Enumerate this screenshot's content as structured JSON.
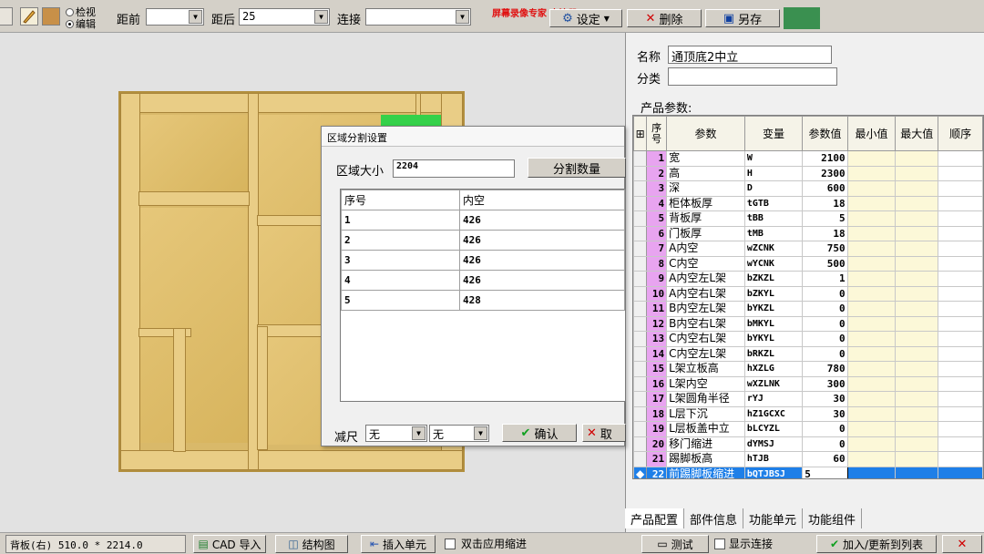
{
  "toolbar": {
    "radio_view": "检视",
    "radio_edit": "编辑",
    "dist_front_label": "距前",
    "dist_front_value": "",
    "dist_back_label": "距后",
    "dist_back_value": "25",
    "connect_label": "连接",
    "connect_value": "",
    "watermark": "屏幕录像专家 未注册",
    "settings_btn": "设定",
    "delete_btn": "删除",
    "saveas_btn": "另存"
  },
  "right_panel": {
    "name_label": "名称",
    "name_value": "通顶底2中立",
    "category_label": "分类",
    "category_value": "",
    "params_title": "产品参数:",
    "columns": [
      "序号",
      "参数",
      "变量",
      "参数值",
      "最小值",
      "最大值",
      "顺序"
    ],
    "rows": [
      {
        "n": "1",
        "param": "宽",
        "var": "W",
        "val": "2100"
      },
      {
        "n": "2",
        "param": "高",
        "var": "H",
        "val": "2300"
      },
      {
        "n": "3",
        "param": "深",
        "var": "D",
        "val": "600"
      },
      {
        "n": "4",
        "param": "柜体板厚",
        "var": "tGTB",
        "val": "18"
      },
      {
        "n": "5",
        "param": "背板厚",
        "var": "tBB",
        "val": "5"
      },
      {
        "n": "6",
        "param": "门板厚",
        "var": "tMB",
        "val": "18"
      },
      {
        "n": "7",
        "param": "A内空",
        "var": "wZCNK",
        "val": "750"
      },
      {
        "n": "8",
        "param": "C内空",
        "var": "wYCNK",
        "val": "500"
      },
      {
        "n": "9",
        "param": "A内空左L架",
        "var": "bZKZL",
        "val": "1"
      },
      {
        "n": "10",
        "param": "A内空右L架",
        "var": "bZKYL",
        "val": "0"
      },
      {
        "n": "11",
        "param": "B内空左L架",
        "var": "bYKZL",
        "val": "0"
      },
      {
        "n": "12",
        "param": "B内空右L架",
        "var": "bMKYL",
        "val": "0"
      },
      {
        "n": "13",
        "param": "C内空右L架",
        "var": "bYKYL",
        "val": "0"
      },
      {
        "n": "14",
        "param": "C内空左L架",
        "var": "bRKZL",
        "val": "0"
      },
      {
        "n": "15",
        "param": "L架立板高",
        "var": "hXZLG",
        "val": "780"
      },
      {
        "n": "16",
        "param": "L架内空",
        "var": "wXZLNK",
        "val": "300"
      },
      {
        "n": "17",
        "param": "L架圆角半径",
        "var": "rYJ",
        "val": "30"
      },
      {
        "n": "18",
        "param": "L层下沉",
        "var": "hZ1GCXC",
        "val": "30"
      },
      {
        "n": "19",
        "param": "L层板盖中立",
        "var": "bLCYZL",
        "val": "0"
      },
      {
        "n": "20",
        "param": "移门缩进",
        "var": "dYMSJ",
        "val": "0"
      },
      {
        "n": "21",
        "param": "踢脚板高",
        "var": "hTJB",
        "val": "60"
      },
      {
        "n": "22",
        "param": "前踢脚板缩进",
        "var": "bQTJBSJ",
        "val": "5"
      }
    ],
    "tabs": [
      "产品配置",
      "部件信息",
      "功能单元",
      "功能组件"
    ]
  },
  "dialog": {
    "title": "区域分割设置",
    "size_label": "区域大小",
    "size_value": "2204",
    "split_btn": "分割数量",
    "col_index": "序号",
    "col_inner": "内空",
    "rows": [
      {
        "n": "1",
        "v": "426"
      },
      {
        "n": "2",
        "v": "426"
      },
      {
        "n": "3",
        "v": "426"
      },
      {
        "n": "4",
        "v": "426"
      },
      {
        "n": "5",
        "v": "428"
      }
    ],
    "reduce_label": "减尺",
    "reduce_a": "无",
    "reduce_b": "无",
    "ok_btn": "确认",
    "cancel_btn": "取"
  },
  "status": {
    "board_info": "背板(右) 510.0 * 2214.0",
    "cad_import": "CAD 导入",
    "structure": "结构图",
    "insert_unit": "插入单元",
    "dblclick_indent": "双击应用缩进",
    "test_btn": "测试",
    "show_connect": "显示连接",
    "add_update": "加入/更新到列表"
  },
  "colors": {
    "selected_row": "#1e7fe8",
    "index_col": "#e8a4f0",
    "wood": "#e9cd86"
  }
}
